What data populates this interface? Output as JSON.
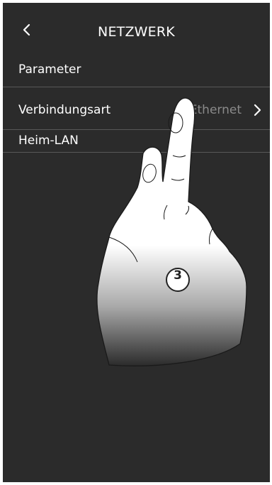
{
  "header": {
    "title": "NETZWERK",
    "back_icon": "chevron-left-icon"
  },
  "section": {
    "label": "Parameter"
  },
  "rows": [
    {
      "label": "Verbindungsart",
      "value": "Ethernet",
      "icon": "chevron-right-icon"
    },
    {
      "label": "Heim-LAN"
    }
  ],
  "overlay": {
    "step_number": "3",
    "hand_icon": "pointing-hand-icon"
  },
  "colors": {
    "background": "#2b2b2b",
    "text": "#ffffff",
    "value_text": "#8a8a8a",
    "divider": "#585858"
  }
}
